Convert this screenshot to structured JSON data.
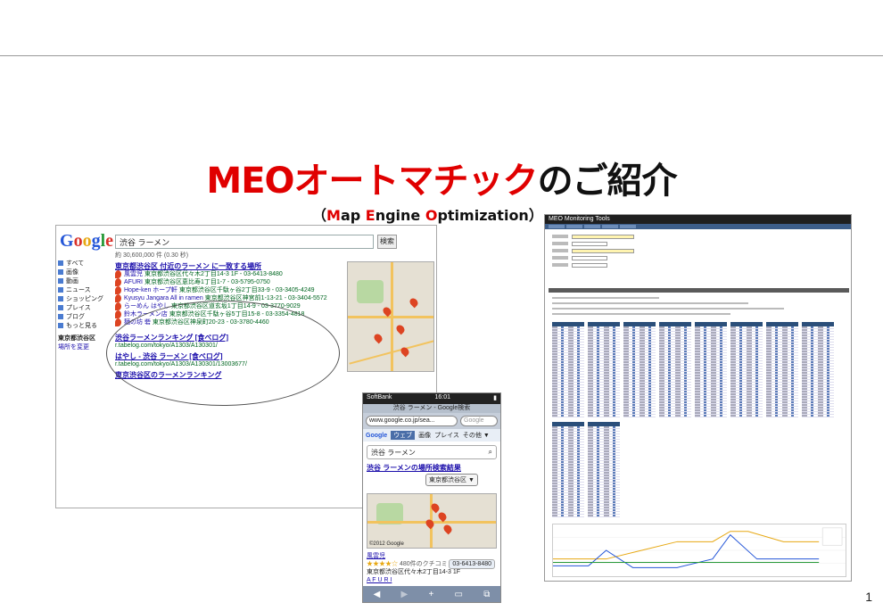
{
  "title": {
    "part_red": "MEOオートマチック",
    "part_black": "のご紹介"
  },
  "subtitle": {
    "open": "（",
    "m": "M",
    "ap": "ap ",
    "e": "E",
    "ngine": "ngine ",
    "o": "O",
    "ptimization": "ptimization",
    "close": "）"
  },
  "page_number": "1",
  "serp": {
    "logo": [
      "G",
      "o",
      "o",
      "g",
      "l",
      "e"
    ],
    "query": "渋谷 ラーメン",
    "search_button": "検索",
    "stats": "約 30,600,000 件 (0.30 秒)",
    "side_items": [
      "すべて",
      "画像",
      "動画",
      "ニュース",
      "ショッピング",
      "プレイス",
      "ブログ",
      "もっと見る"
    ],
    "side_region": [
      "東京都渋谷区",
      "場所を変更"
    ],
    "local_heading": "東京都渋谷区 付近のラーメン に一致する場所",
    "local_results": [
      {
        "name": "風雲児",
        "addr": "東京都渋谷区代々木2丁目14-3 1F - 03-6413-8480"
      },
      {
        "name": "AFURI",
        "addr": "東京都渋谷区恵比寿1丁目1-7 - 03-5795-0750"
      },
      {
        "name": "Hope-ken ホープ軒",
        "addr": "東京都渋谷区千駄ヶ谷2丁目33-9 - 03-3405-4249"
      },
      {
        "name": "Kyusyu Jangara  All in ramen",
        "addr": "東京都渋谷区神宮前1-13-21 - 03-3404-5572"
      },
      {
        "name": "らーめん はやし",
        "addr": "東京都渋谷区道玄坂1丁目14-9 - 03-3770-9029"
      },
      {
        "name": "鈴木ラーメン店",
        "addr": "東京都渋谷区千駄ヶ谷5丁目15-8 - 03-3354-4818"
      },
      {
        "name": "麺の坊 砦",
        "addr": "東京都渋谷区神泉町20-23 - 03-3780-4460"
      }
    ],
    "web_results": [
      {
        "title": "渋谷ラーメンランキング [食べログ]",
        "url": "r.tabelog.com/tokyo/A1303/A130301/"
      },
      {
        "title": "はやし - 渋谷 ラーメン [食べログ]",
        "url": "r.tabelog.com/tokyo/A1303/A130301/13003677/"
      },
      {
        "title": "東京渋谷区のラーメンランキング",
        "url": ""
      }
    ]
  },
  "phone": {
    "carrier": "SoftBank",
    "time": "16:01",
    "page_title": "渋谷 ラーメン - Google検索",
    "url": "www.google.co.jp/sea...",
    "search_placeholder": "Google",
    "nav": [
      "ウェブ",
      "画像",
      "プレイス",
      "その他 ▼"
    ],
    "query": "渋谷 ラーメン",
    "local_heading": "渋谷 ラーメンの場所検索結果",
    "area_select": "東京都渋谷区 ▼",
    "entry_name": "風雲児",
    "entry_reviews": "480件のクチコミ",
    "entry_addr": "東京都渋谷区代々木2丁目14-3 1F",
    "entry_tel": "03-6413-8480",
    "entry2_name": "A F U R I",
    "map_credit": "©2012 Google"
  },
  "tool": {
    "title": "MEO Monitoring Tools"
  }
}
